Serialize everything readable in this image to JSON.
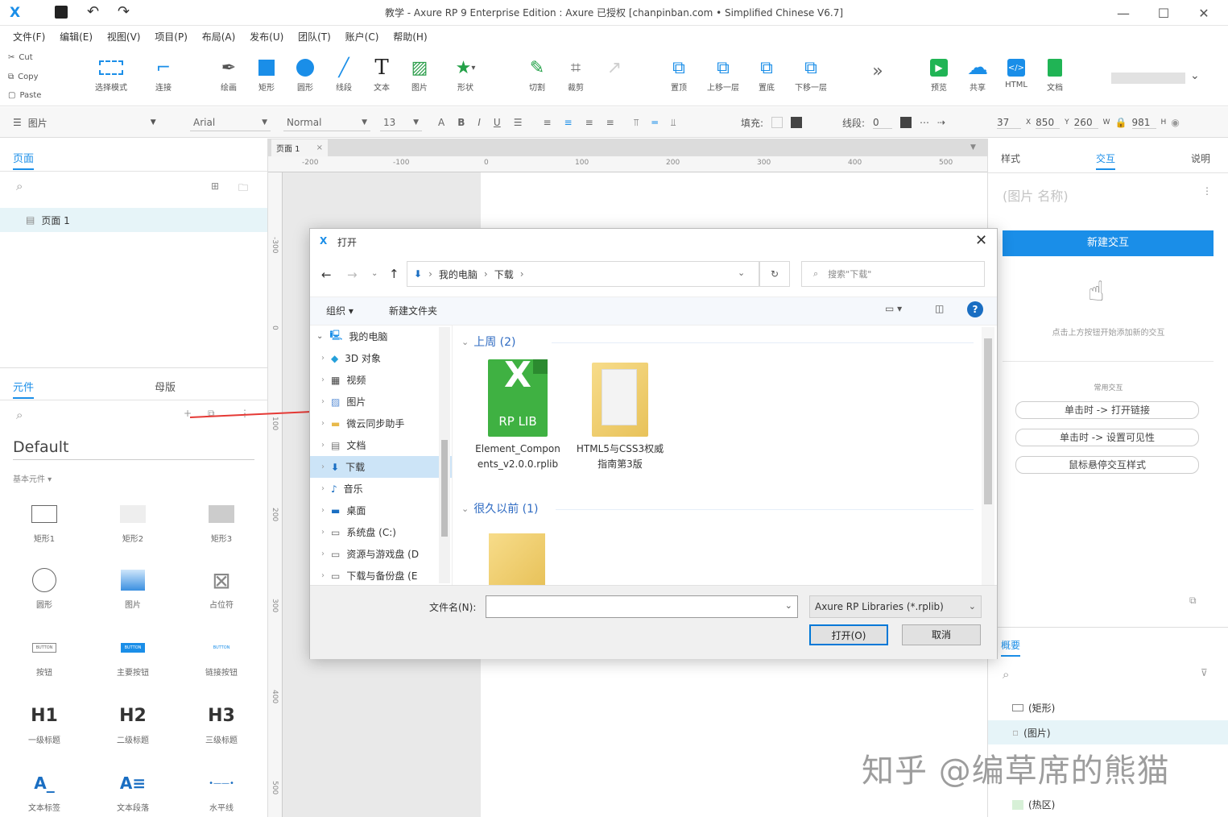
{
  "window": {
    "title": "教学 - Axure RP 9 Enterprise Edition : Axure 已授权 [chanpinban.com • Simplified Chinese V6.7]",
    "brand_color": "#1a8ee8"
  },
  "menu": [
    "文件(F)",
    "编辑(E)",
    "视图(V)",
    "项目(P)",
    "布局(A)",
    "发布(U)",
    "团队(T)",
    "账户(C)",
    "帮助(H)"
  ],
  "clipboard": [
    "Cut",
    "Copy",
    "Paste"
  ],
  "tools": [
    {
      "label": "选择模式",
      "icon": "select-mode-icon"
    },
    {
      "label": "连接",
      "icon": "connect-icon"
    },
    {
      "label": "绘画",
      "icon": "pen-icon"
    },
    {
      "label": "矩形",
      "icon": "rectangle-icon"
    },
    {
      "label": "圆形",
      "icon": "circle-icon"
    },
    {
      "label": "线段",
      "icon": "line-icon"
    },
    {
      "label": "文本",
      "icon": "text-icon"
    },
    {
      "label": "图片",
      "icon": "image-icon"
    },
    {
      "label": "形状",
      "icon": "star-icon"
    },
    {
      "label": "切割",
      "icon": "slice-icon"
    },
    {
      "label": "裁剪",
      "icon": "crop-icon"
    },
    {
      "label": "置顶",
      "icon": "bring-front-icon"
    },
    {
      "label": "上移一层",
      "icon": "bring-forward-icon"
    },
    {
      "label": "置底",
      "icon": "send-back-icon"
    },
    {
      "label": "下移一层",
      "icon": "send-backward-icon"
    },
    {
      "label": "预览",
      "icon": "preview-icon"
    },
    {
      "label": "共享",
      "icon": "cloud-share-icon"
    },
    {
      "label": "HTML",
      "icon": "html-icon"
    },
    {
      "label": "文档",
      "icon": "document-icon"
    }
  ],
  "format": {
    "widget_type": "图片",
    "font": "Arial",
    "weight": "Normal",
    "size": "13",
    "fill_label": "填充:",
    "stroke_label": "线段:",
    "stroke_value": "0",
    "x": "37",
    "x_label": "X",
    "y": "850",
    "y_label": "Y",
    "w": "260",
    "w_label": "W",
    "h": "981",
    "h_label": "H"
  },
  "left": {
    "pages_tab": "页面",
    "page_items": [
      "页面 1"
    ],
    "widgets_tab": "元件",
    "masters_tab": "母版",
    "library": "Default",
    "category": "基本元件 ▾",
    "widgets": [
      "矩形1",
      "矩形2",
      "矩形3",
      "圆形",
      "图片",
      "占位符",
      "按钮",
      "主要按钮",
      "链接按钮",
      "一级标题",
      "二级标题",
      "三级标题",
      "文本标签",
      "文本段落",
      "水平线"
    ],
    "heading_glyphs": [
      "H1",
      "H2",
      "H3"
    ],
    "button_glyph": "BUTTON"
  },
  "canvas": {
    "tab": "页面 1",
    "ruler_h": [
      "-200",
      "-100",
      "0",
      "100",
      "200",
      "300",
      "400",
      "500"
    ],
    "ruler_v": [
      "-300",
      "0",
      "100",
      "200",
      "300",
      "400",
      "500"
    ]
  },
  "right": {
    "tabs": [
      "样式",
      "交互",
      "说明"
    ],
    "active_tab": "交互",
    "name_placeholder": "(图片 名称)",
    "new_button": "新建交互",
    "hint": "点击上方按钮开始添加新的交互",
    "common_label": "常用交互",
    "common": [
      "单击时 -> 打开链接",
      "单击时 -> 设置可见性",
      "鼠标悬停交互样式"
    ],
    "outline_tab": "概要",
    "outline": [
      "(矩形)",
      "(图片)",
      "(热区)"
    ]
  },
  "dialog": {
    "title": "打开",
    "breadcrumb": [
      "我的电脑",
      "下载"
    ],
    "search_placeholder": "搜索\"下载\"",
    "organize": "组织 ▾",
    "new_folder": "新建文件夹",
    "tree": [
      "我的电脑",
      "3D 对象",
      "视频",
      "图片",
      "微云同步助手",
      "文档",
      "下载",
      "音乐",
      "桌面",
      "系统盘 (C:)",
      "资源与游戏盘 (D",
      "下载与备份盘 (E"
    ],
    "selected_tree": "下载",
    "groups": [
      "上周 (2)",
      "很久以前 (1)"
    ],
    "files": [
      "Element_Components_v2.0.0.rplib",
      "HTML5与CSS3权威指南第3版"
    ],
    "rplib_badge": "RP LIB",
    "filename_label": "文件名(N):",
    "filename_value": "",
    "filter": "Axure RP Libraries (*.rplib)",
    "open": "打开(O)",
    "cancel": "取消"
  },
  "watermark": "知乎 @编草席的熊猫"
}
